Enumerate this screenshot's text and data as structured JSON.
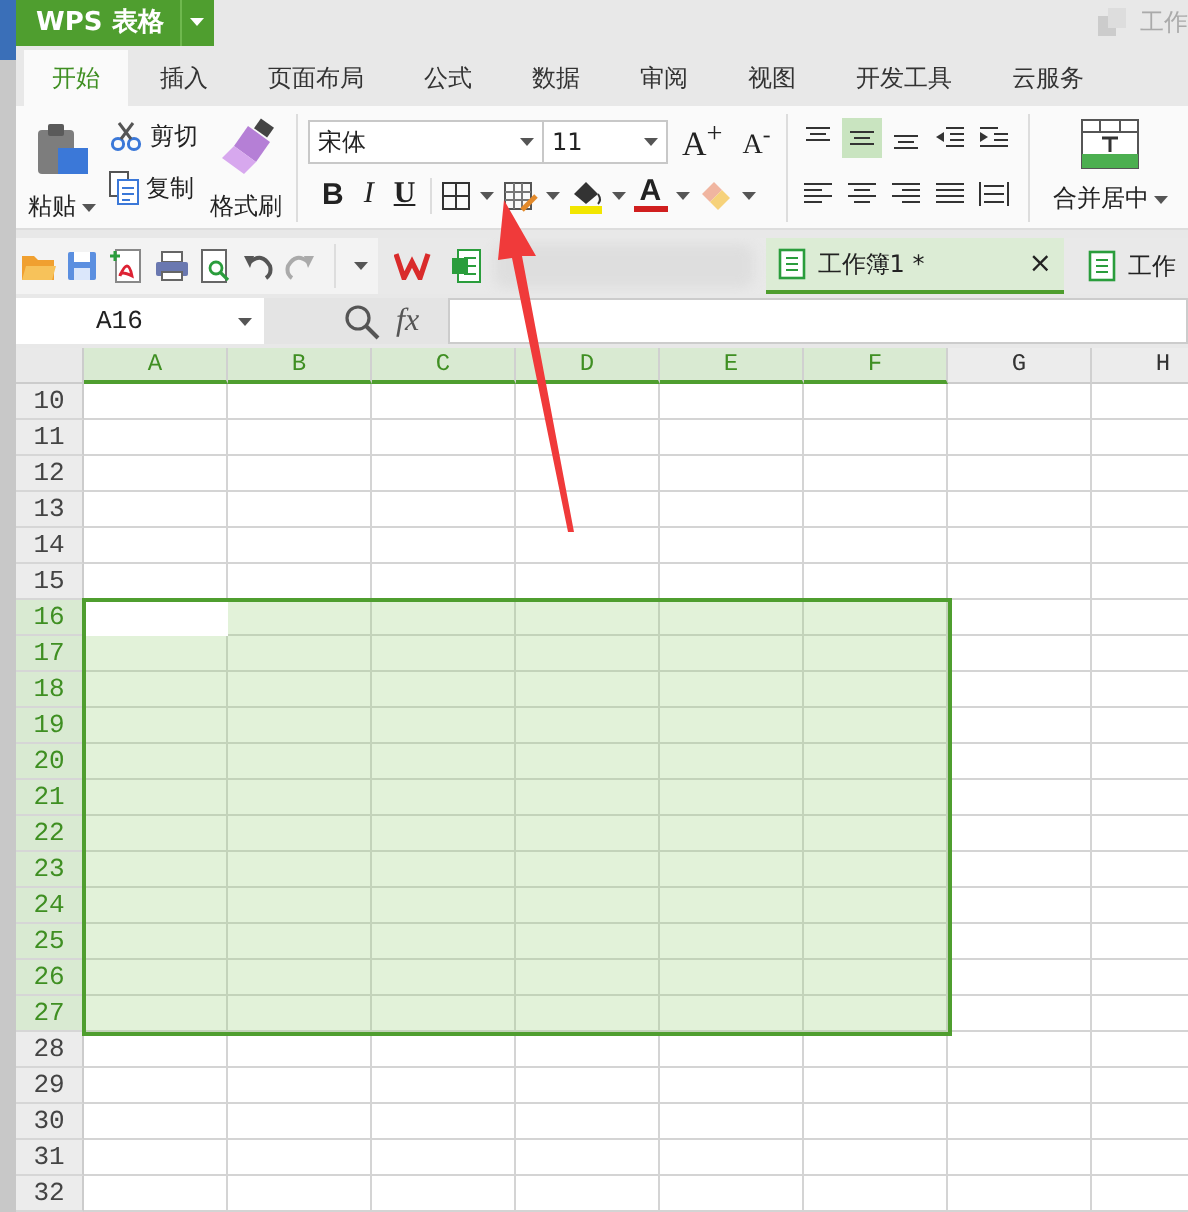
{
  "app": {
    "title": "WPS 表格",
    "corner_text": "工作"
  },
  "ribbon_tabs": [
    {
      "label": "开始",
      "selected": true
    },
    {
      "label": "插入",
      "selected": false
    },
    {
      "label": "页面布局",
      "selected": false
    },
    {
      "label": "公式",
      "selected": false
    },
    {
      "label": "数据",
      "selected": false
    },
    {
      "label": "审阅",
      "selected": false
    },
    {
      "label": "视图",
      "selected": false
    },
    {
      "label": "开发工具",
      "selected": false
    },
    {
      "label": "云服务",
      "selected": false
    }
  ],
  "clipboard": {
    "paste": "粘贴",
    "cut": "剪切",
    "copy": "复制",
    "format_painter": "格式刷"
  },
  "font": {
    "name": "宋体",
    "size": "11",
    "buttons": [
      {
        "kind": "text",
        "label": "B"
      },
      {
        "kind": "text",
        "label": "I"
      },
      {
        "kind": "text",
        "label": "U"
      },
      {
        "kind": "border"
      },
      {
        "kind": "cellstyle"
      },
      {
        "kind": "fill"
      },
      {
        "kind": "fontcolor",
        "label": "A"
      },
      {
        "kind": "eraser"
      }
    ],
    "grow": "A$^{+}$",
    "shrink": "A$^{-}$"
  },
  "alignment": [
    {
      "kind": "top",
      "selected": false
    },
    {
      "kind": "middle",
      "selected": true
    },
    {
      "kind": "bottom",
      "selected": false
    },
    {
      "kind": "outdent",
      "selected": false
    },
    {
      "kind": "indent",
      "selected": false
    },
    {
      "kind": "left",
      "selected": false
    },
    {
      "kind": "center",
      "selected": false
    },
    {
      "kind": "right",
      "selected": false
    },
    {
      "kind": "justify",
      "selected": false
    },
    {
      "kind": "distribute",
      "selected": false
    }
  ],
  "merge": {
    "label": "合并居中"
  },
  "quick_tools": [
    {
      "kind": "open"
    },
    {
      "kind": "save"
    },
    {
      "kind": "pdf"
    },
    {
      "kind": "print"
    },
    {
      "kind": "preview"
    },
    {
      "kind": "undo"
    },
    {
      "kind": "redo"
    }
  ],
  "doc_tabs": [
    {
      "label": "工作簿1 *",
      "selected": true,
      "close": "×"
    },
    {
      "label": "工作",
      "selected": false
    }
  ],
  "formula_bar": {
    "name_box": "A16",
    "fx": "fx"
  },
  "columns": [
    {
      "label": "A",
      "selected": true,
      "active": true
    },
    {
      "label": "B",
      "selected": true,
      "active": false
    },
    {
      "label": "C",
      "selected": true,
      "active": false
    },
    {
      "label": "D",
      "selected": true,
      "active": false
    },
    {
      "label": "E",
      "selected": true,
      "active": false
    },
    {
      "label": "F",
      "selected": true,
      "active": false
    },
    {
      "label": "G",
      "selected": false,
      "active": false
    },
    {
      "label": "H",
      "selected": false,
      "active": false
    }
  ],
  "rows": [
    {
      "label": "10",
      "selected": false,
      "active": false
    },
    {
      "label": "11",
      "selected": false,
      "active": false
    },
    {
      "label": "12",
      "selected": false,
      "active": false
    },
    {
      "label": "13",
      "selected": false,
      "active": false
    },
    {
      "label": "14",
      "selected": false,
      "active": false
    },
    {
      "label": "15",
      "selected": false,
      "active": false
    },
    {
      "label": "16",
      "selected": true,
      "active": true
    },
    {
      "label": "17",
      "selected": true,
      "active": false
    },
    {
      "label": "18",
      "selected": true,
      "active": false
    },
    {
      "label": "19",
      "selected": true,
      "active": false
    },
    {
      "label": "20",
      "selected": true,
      "active": false
    },
    {
      "label": "21",
      "selected": true,
      "active": false
    },
    {
      "label": "22",
      "selected": true,
      "active": false
    },
    {
      "label": "23",
      "selected": true,
      "active": false
    },
    {
      "label": "24",
      "selected": true,
      "active": false
    },
    {
      "label": "25",
      "selected": true,
      "active": false
    },
    {
      "label": "26",
      "selected": true,
      "active": false
    },
    {
      "label": "27",
      "selected": true,
      "active": false
    },
    {
      "label": "28",
      "selected": false,
      "active": false
    },
    {
      "label": "29",
      "selected": false,
      "active": false
    },
    {
      "label": "30",
      "selected": false,
      "active": false
    },
    {
      "label": "31",
      "selected": false,
      "active": false
    },
    {
      "label": "32",
      "selected": false,
      "active": false
    }
  ],
  "annotation": {
    "kind": "arrow"
  }
}
